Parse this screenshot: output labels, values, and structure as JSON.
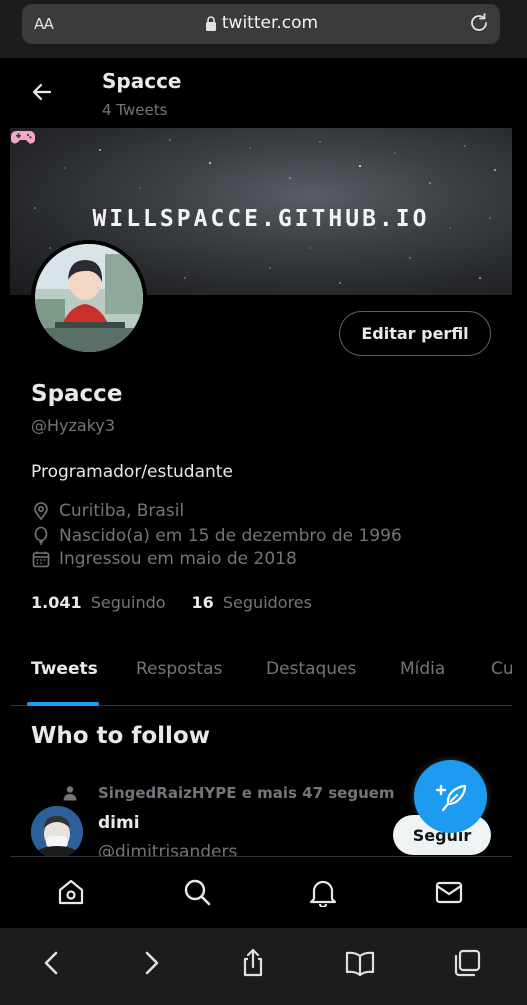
{
  "browser": {
    "text_size_label": "AA",
    "domain": "twitter.com",
    "icons": [
      "lock-icon",
      "reload-icon",
      "back-icon",
      "forward-icon",
      "share-icon",
      "bookmarks-icon",
      "tabs-icon"
    ]
  },
  "header": {
    "name": "Spacce",
    "tweet_count": "4 Tweets"
  },
  "banner": {
    "text": "WILLSPACCE.GITHUB.IO"
  },
  "profile": {
    "edit_button": "Editar perfil",
    "name": "Spacce",
    "handle": "@Hyzaky3",
    "bio": "Programador/estudante",
    "location": "Curitiba, Brasil",
    "birth": "Nascido(a) em 15 de dezembro de 1996",
    "joined": "Ingressou em maio de 2018",
    "following_count": "1.041",
    "following_label": "Seguindo",
    "followers_count": "16",
    "followers_label": "Seguidores"
  },
  "tabs": [
    {
      "label": "Tweets",
      "active": true
    },
    {
      "label": "Respostas",
      "active": false
    },
    {
      "label": "Destaques",
      "active": false
    },
    {
      "label": "Mídia",
      "active": false
    },
    {
      "label": "Cu",
      "active": false
    }
  ],
  "who_to_follow": {
    "title": "Who to follow",
    "context": "SingedRaizHYPE e mais 47 seguem",
    "suggestion": {
      "name": "dimi",
      "handle": "@dimitrisanders",
      "button": "Seguir"
    }
  },
  "colors": {
    "accent": "#1d9bf0",
    "background": "#000000",
    "secondary_text": "#71767b",
    "primary_text": "#e7e9ea"
  }
}
